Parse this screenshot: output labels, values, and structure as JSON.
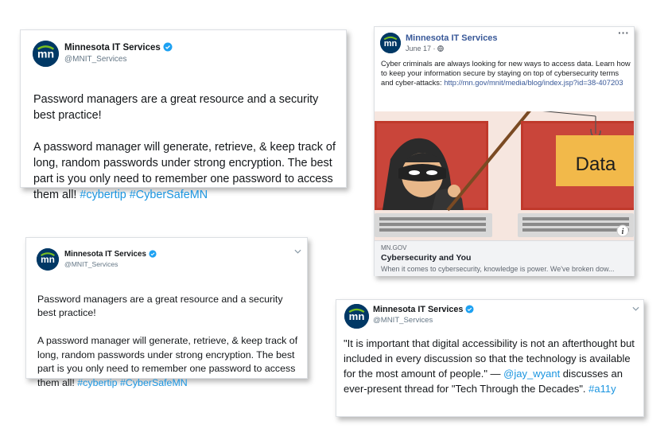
{
  "tweet_top_left": {
    "name": "Minnesota IT Services",
    "handle": "@MNIT_Services",
    "text_1": "Password managers are a great resource and a security best practice!",
    "text_2": "A password manager will generate, retrieve, & keep track of long, random passwords under strong encryption. The best part is you only need to remember one password to access them all! ",
    "hashtag_1": "#cybertip",
    "hashtag_2": "#CyberSafeMN"
  },
  "facebook_post": {
    "name": "Minnesota IT Services",
    "date": "June 17 · ",
    "body": "Cyber criminals are always looking for new ways to access data. Learn how to keep your information secure by staying on top of cybersecurity terms and cyber-attacks: ",
    "link": "http://mn.gov/mnit/media/blog/index.jsp?id=38-407203",
    "image_label": "Data",
    "link_domain": "MN.GOV",
    "link_title": "Cybersecurity and You",
    "link_description": "When it comes to cybersecurity, knowledge is power. We've broken dow..."
  },
  "tweet_bottom_left": {
    "name": "Minnesota IT Services",
    "handle": "@MNIT_Services",
    "text_1": "Password managers are a great resource and a security best practice!",
    "text_2": "A password manager will generate, retrieve, & keep track of long, random passwords under strong encryption. The best part is you only need to remember one password to access them all! ",
    "hashtag_1": "#cybertip",
    "hashtag_2": "#CyberSafeMN"
  },
  "tweet_bottom_right": {
    "name": "Minnesota IT Services",
    "handle": "@MNIT_Services",
    "text_1": "\"It is important that digital accessibility is not an afterthought but included in every discussion so that the technology is available for the most amount of people.\" — ",
    "mention": "@jay_wyant",
    "text_2": " discusses an ever-present thread for \"Tech Through the Decades\". ",
    "hashtag": "#a11y"
  },
  "colors": {
    "brand_navy": "#003865",
    "brand_green": "#78be20",
    "twitter_blue": "#1b95e0",
    "facebook_blue": "#385898"
  },
  "icons": [
    "mn-logo-icon",
    "verified-badge-icon",
    "chevron-down-icon",
    "more-options-icon",
    "globe-icon",
    "info-icon"
  ]
}
